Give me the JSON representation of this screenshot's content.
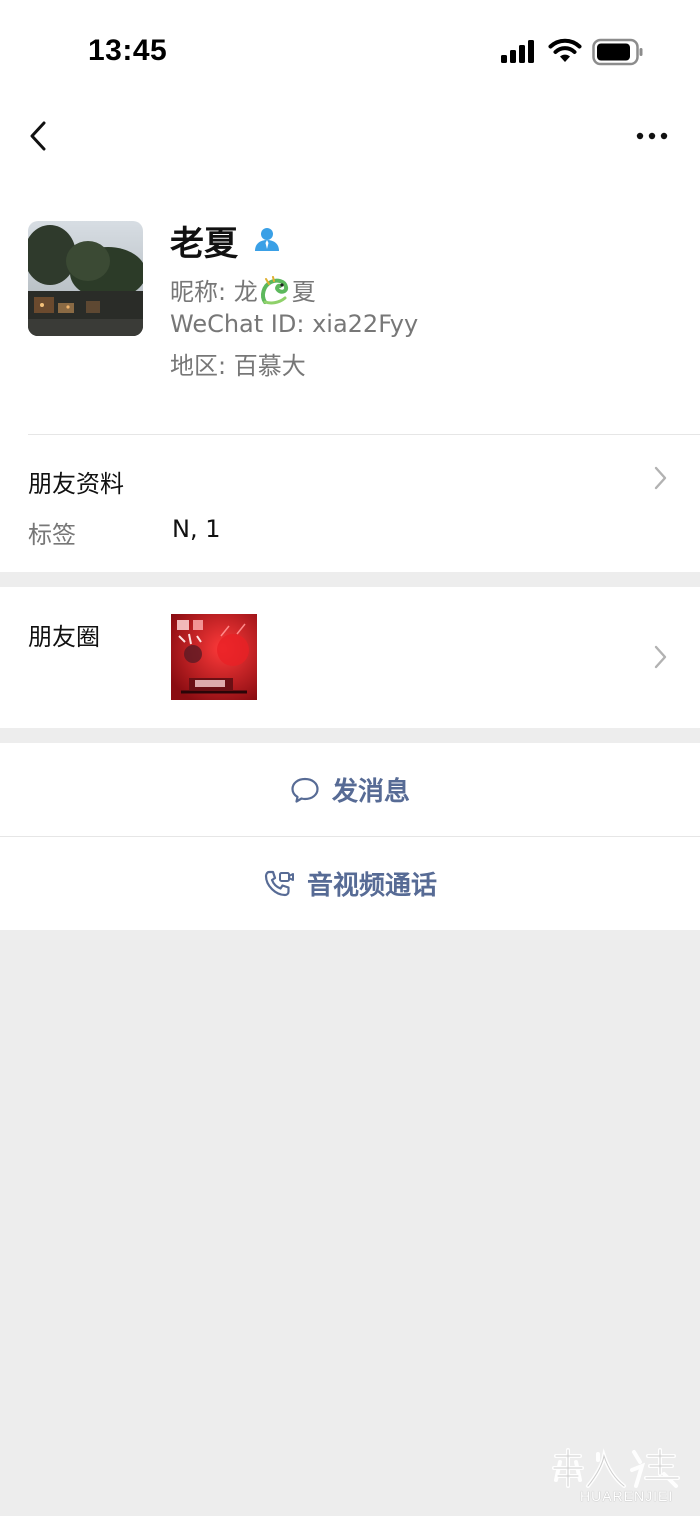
{
  "status_bar": {
    "time": "13:45"
  },
  "profile": {
    "name": "老夏",
    "nickname_label": "昵称: ",
    "nickname_pre": "龙",
    "nickname_post": "夏",
    "wechat_id_label": "WeChat ID: ",
    "wechat_id": "xia22Fyy",
    "region_label": "地区: ",
    "region": "百慕大"
  },
  "friend_info": {
    "label": "朋友资料",
    "tag_label": "标签",
    "tag_value": "N, 1"
  },
  "moments": {
    "label": "朋友圈"
  },
  "actions": {
    "message_label": "发消息",
    "call_label": "音视频通话"
  },
  "watermark": {
    "text": "HUARENJIEI"
  },
  "colors": {
    "link_blue": "#576b95",
    "badge_blue": "#1aad19",
    "background_gray": "#ededed"
  }
}
